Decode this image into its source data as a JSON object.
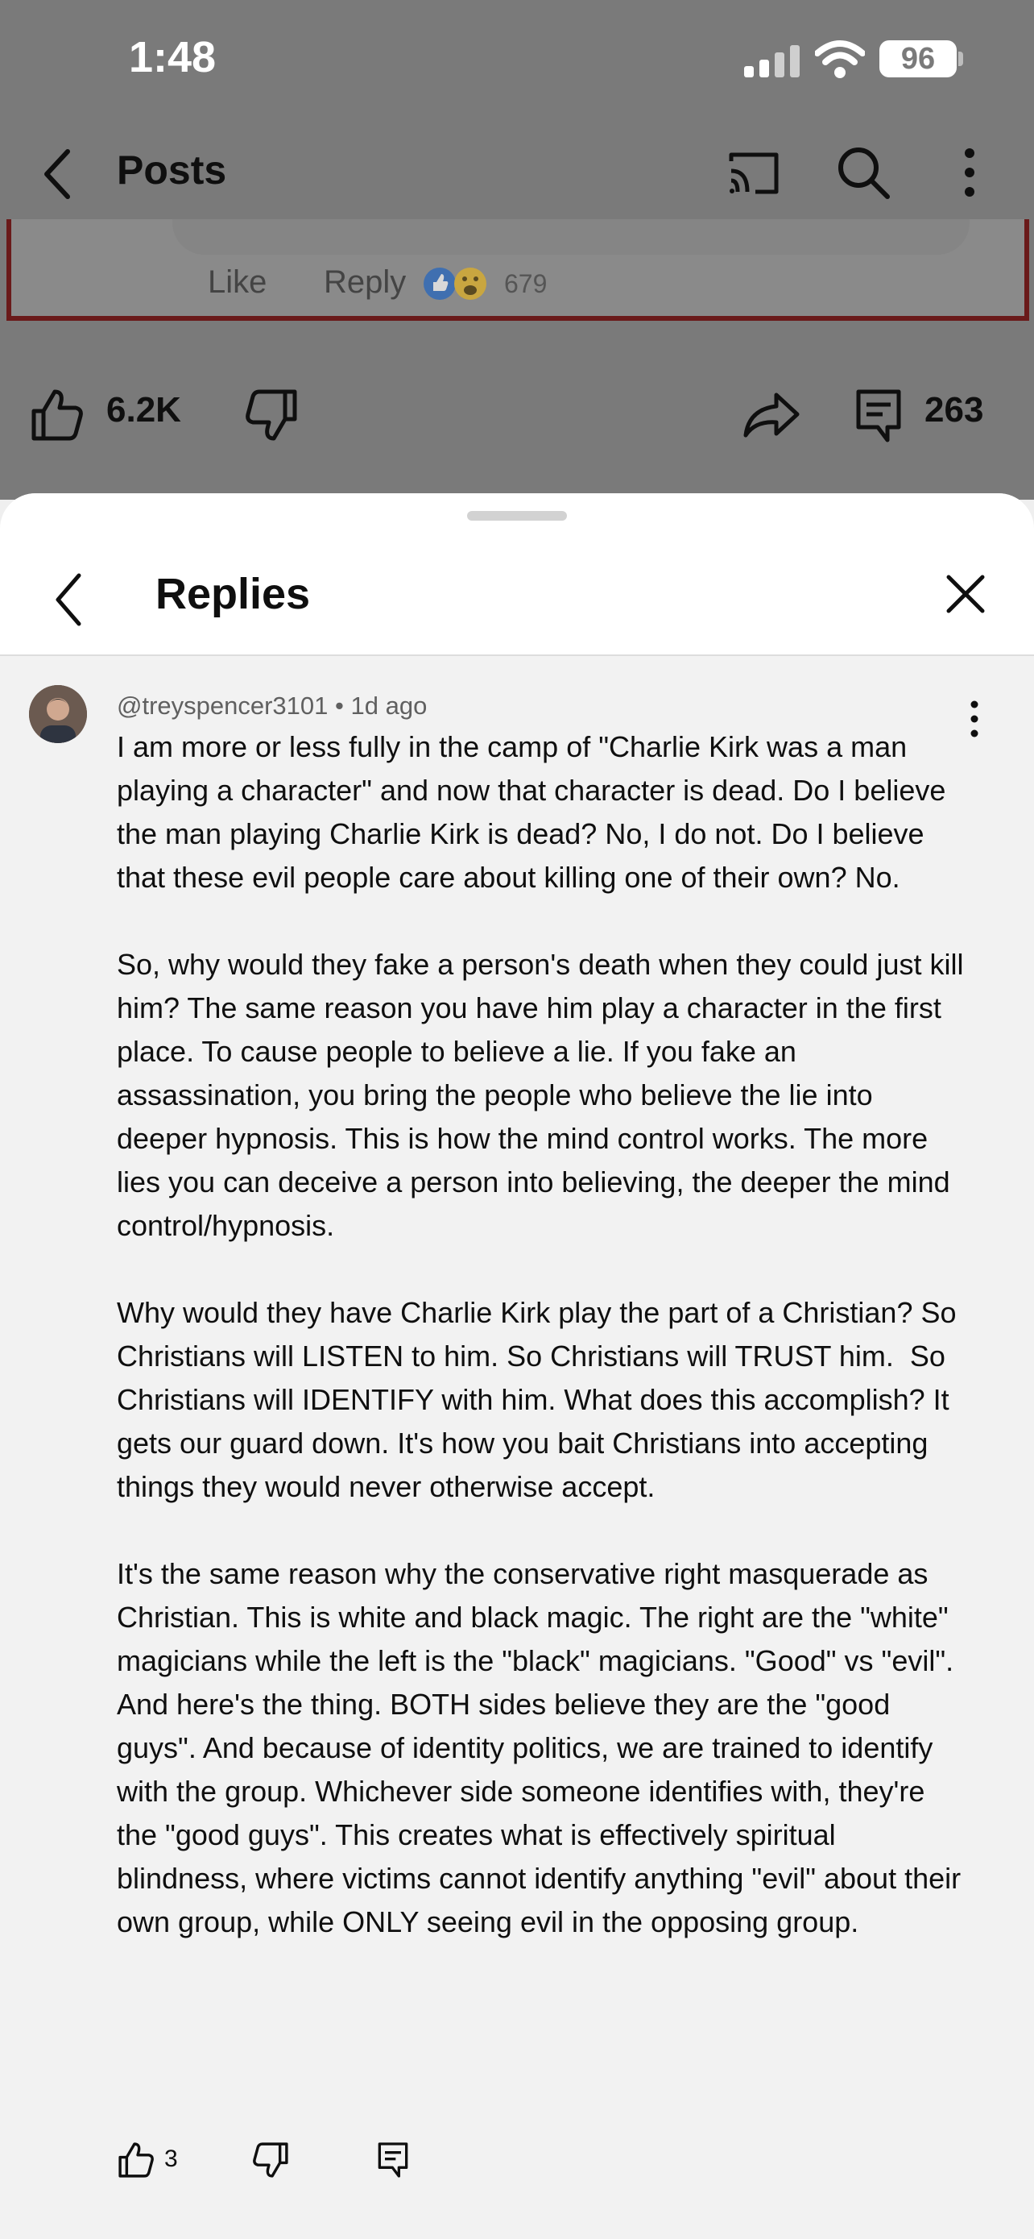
{
  "status_bar": {
    "time": "1:48",
    "battery": "96"
  },
  "top_bar": {
    "title": "Posts"
  },
  "post_image": {
    "like": "Like",
    "reply": "Reply",
    "reaction_count": "679"
  },
  "post_actions": {
    "likes": "6.2K",
    "comments": "263"
  },
  "sheet": {
    "title": "Replies"
  },
  "comment": {
    "author": "@treyspencer3101",
    "separator": "•",
    "age": "1d ago",
    "text": "I am more or less fully in the camp of \"Charlie Kirk was a man playing a character\" and now that character is dead. Do I believe the man playing Charlie Kirk is dead? No, I do not. Do I believe that these evil people care about killing one of their own? No.\n\nSo, why would they fake a person's death when they could just kill him? The same reason you have him play a character in the first place. To cause people to believe a lie. If you fake an assassination, you bring the people who believe the lie into deeper hypnosis. This is how the mind control works. The more lies you can deceive a person into believing, the deeper the mind control/hypnosis.\n\nWhy would they have Charlie Kirk play the part of a Christian? So Christians will LISTEN to him. So Christians will TRUST him.  So Christians will IDENTIFY with him. What does this accomplish? It gets our guard down. It's how you bait Christians into accepting things they would never otherwise accept.\n\nIt's the same reason why the conservative right masquerade as Christian. This is white and black magic. The right are the \"white\" magicians while the left is the \"black\" magicians. \"Good\" vs \"evil\". And here's the thing. BOTH sides believe they are the \"good guys\". And because of identity politics, we are trained to identify with the group. Whichever side someone identifies with, they're the \"good guys\". This creates what is effectively spiritual blindness, where victims cannot identify anything \"evil\" about their own group, while ONLY seeing evil in the opposing group.",
    "likes": "3"
  },
  "icons": [
    "signal-icon",
    "wifi-icon",
    "battery-icon",
    "back-icon",
    "cast-icon",
    "search-icon",
    "more-vert-icon",
    "thumb-up-icon",
    "thumb-down-icon",
    "share-icon",
    "comment-icon",
    "close-icon"
  ],
  "colors": {
    "overlay": "#7a7a7a",
    "sheet": "#f2f2f2",
    "text": "#0f0f0f",
    "meta": "#606060"
  }
}
